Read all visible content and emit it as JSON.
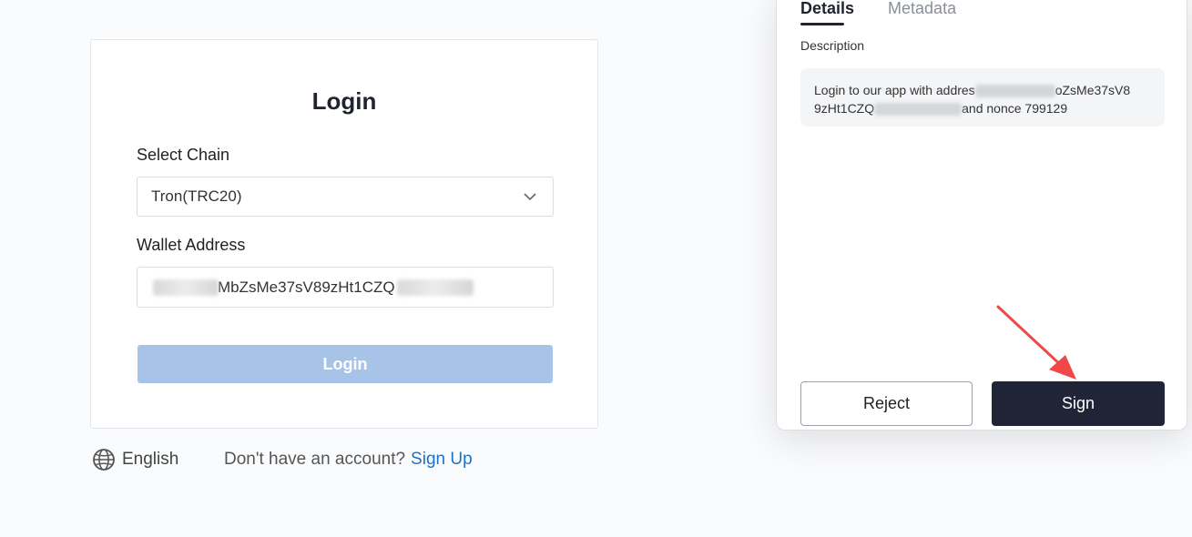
{
  "login": {
    "title": "Login",
    "chain_label": "Select Chain",
    "chain_value": "Tron(TRC20)",
    "wallet_label": "Wallet Address",
    "wallet_value": "MbZsMe37sV89zHt1CZQ",
    "button": "Login"
  },
  "footer": {
    "language": "English",
    "account_prompt": "Don't have an account?",
    "signup_link": "Sign Up"
  },
  "panel": {
    "tabs": [
      "Details",
      "Metadata"
    ],
    "active_tab": "Details",
    "description_label": "Description",
    "description_line1_start": "Login to our app with addres",
    "description_line1_end": "oZsMe37sV8",
    "description_line2_start": "9zHt1CZQ",
    "description_line2_end": "and nonce 799129",
    "reject_label": "Reject",
    "sign_label": "Sign"
  },
  "colors": {
    "login_button_disabled": "#a7c4e8",
    "sign_button": "#1f2536",
    "link": "#1a73c9",
    "annotation_arrow": "#f04848"
  },
  "icons": {
    "chain_dropdown": "chevron-down-icon",
    "language": "globe-icon",
    "annotation": "red-arrow-icon"
  }
}
